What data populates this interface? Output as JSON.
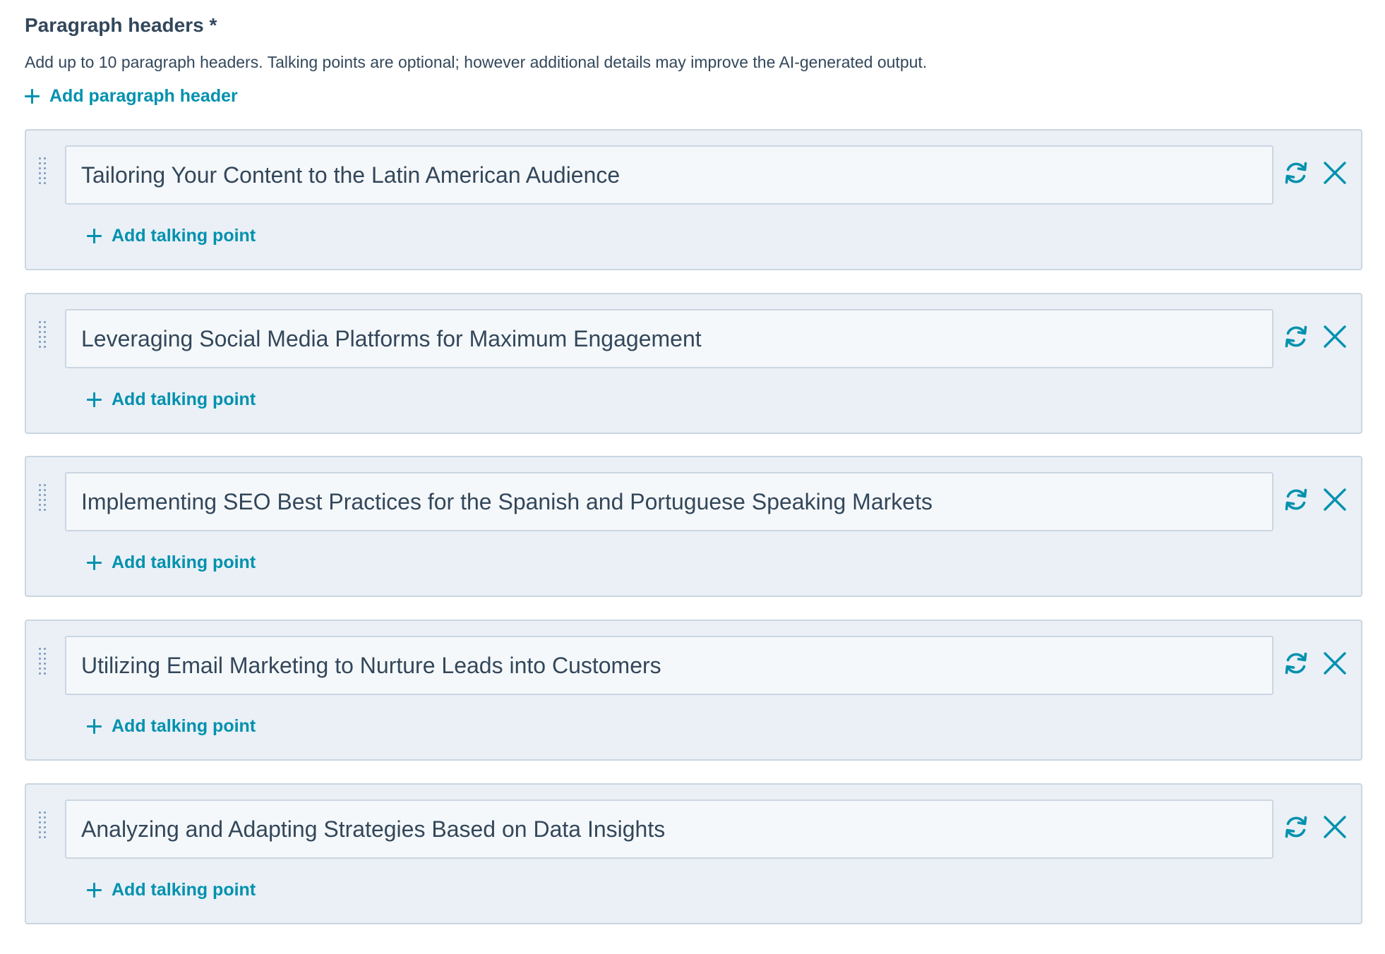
{
  "section": {
    "title": "Paragraph headers *",
    "description": "Add up to 10 paragraph headers. Talking points are optional; however additional details may improve the AI-generated output.",
    "add_header_label": "Add paragraph header"
  },
  "headers": [
    {
      "value": "Tailoring Your Content to the Latin American Audience",
      "add_talking_point_label": "Add talking point"
    },
    {
      "value": "Leveraging Social Media Platforms for Maximum Engagement",
      "add_talking_point_label": "Add talking point"
    },
    {
      "value": "Implementing SEO Best Practices for the Spanish and Portuguese Speaking Markets",
      "add_talking_point_label": "Add talking point"
    },
    {
      "value": "Utilizing Email Marketing to Nurture Leads into Customers",
      "add_talking_point_label": "Add talking point"
    },
    {
      "value": "Analyzing and Adapting Strategies Based on Data Insights",
      "add_talking_point_label": "Add talking point"
    }
  ],
  "icons": {
    "drag": "drag-handle-icon",
    "refresh": "refresh-icon",
    "close": "close-icon",
    "plus": "plus-icon"
  },
  "colors": {
    "accent": "#0091ae",
    "text": "#33475b",
    "card_bg": "#eaf0f6",
    "border": "#cbd6e2",
    "input_bg": "#f5f8fa"
  }
}
